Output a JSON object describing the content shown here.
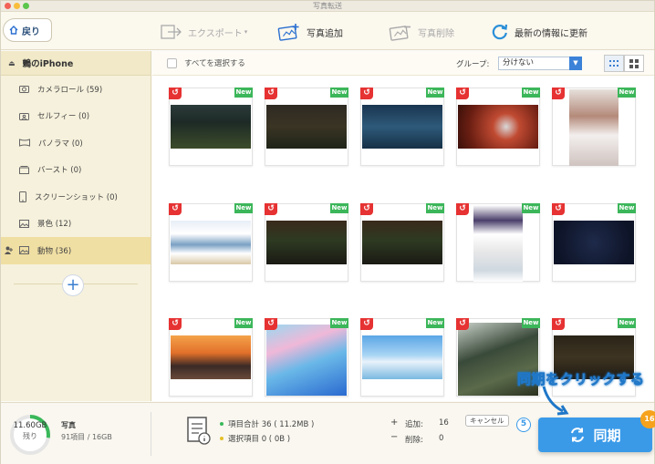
{
  "window": {
    "title": "写真転送"
  },
  "toolbar": {
    "back_label": "戻り",
    "export_label": "エクスポート",
    "add_photo_label": "写真追加",
    "delete_photo_label": "写真削除",
    "refresh_label": "最新の情報に更新"
  },
  "sidebar": {
    "device_name": "鶫のiPhone",
    "items": [
      {
        "label": "カメラロール (59)",
        "icon": "camera-icon",
        "active": false
      },
      {
        "label": "セルフィー (0)",
        "icon": "selfie-icon",
        "active": false
      },
      {
        "label": "パノラマ (0)",
        "icon": "panorama-icon",
        "active": false
      },
      {
        "label": "バースト (0)",
        "icon": "burst-icon",
        "active": false
      },
      {
        "label": "スクリーンショット (0)",
        "icon": "phone-icon",
        "active": false
      },
      {
        "label": "景色 (12)",
        "icon": "image-icon",
        "active": false
      },
      {
        "label": "動物 (36)",
        "icon": "image-icon",
        "active": true
      }
    ]
  },
  "content": {
    "select_all_label": "すべてを選択する",
    "group_label": "グループ:",
    "group_value": "分けない",
    "badge_new": "New"
  },
  "bottom": {
    "storage_capacity": "11.60GB",
    "storage_remaining_label": "残り",
    "storage_type": "写真",
    "storage_detail": "91項目 / 16GB",
    "total_items": "項目合計 36 ( 11.2MB )",
    "selected_items": "選択項目 0 ( 0B )",
    "add_label": "追加:",
    "add_count": "16",
    "delete_label": "削除:",
    "delete_count": "0",
    "plus_sign": "+",
    "minus_sign": "−",
    "cancel_label": "キャンセル",
    "sync_label": "同期",
    "sync_badge": "16",
    "step_number": "5",
    "callout_text": "同期をクリックする"
  },
  "colors": {
    "accent_blue": "#3a9ae8",
    "new_green": "#3cb65a",
    "undo_red": "#e63232",
    "sidebar_bg": "#f6f1dc",
    "active_item": "#f0dfa3",
    "badge_orange": "#f6a21c"
  }
}
